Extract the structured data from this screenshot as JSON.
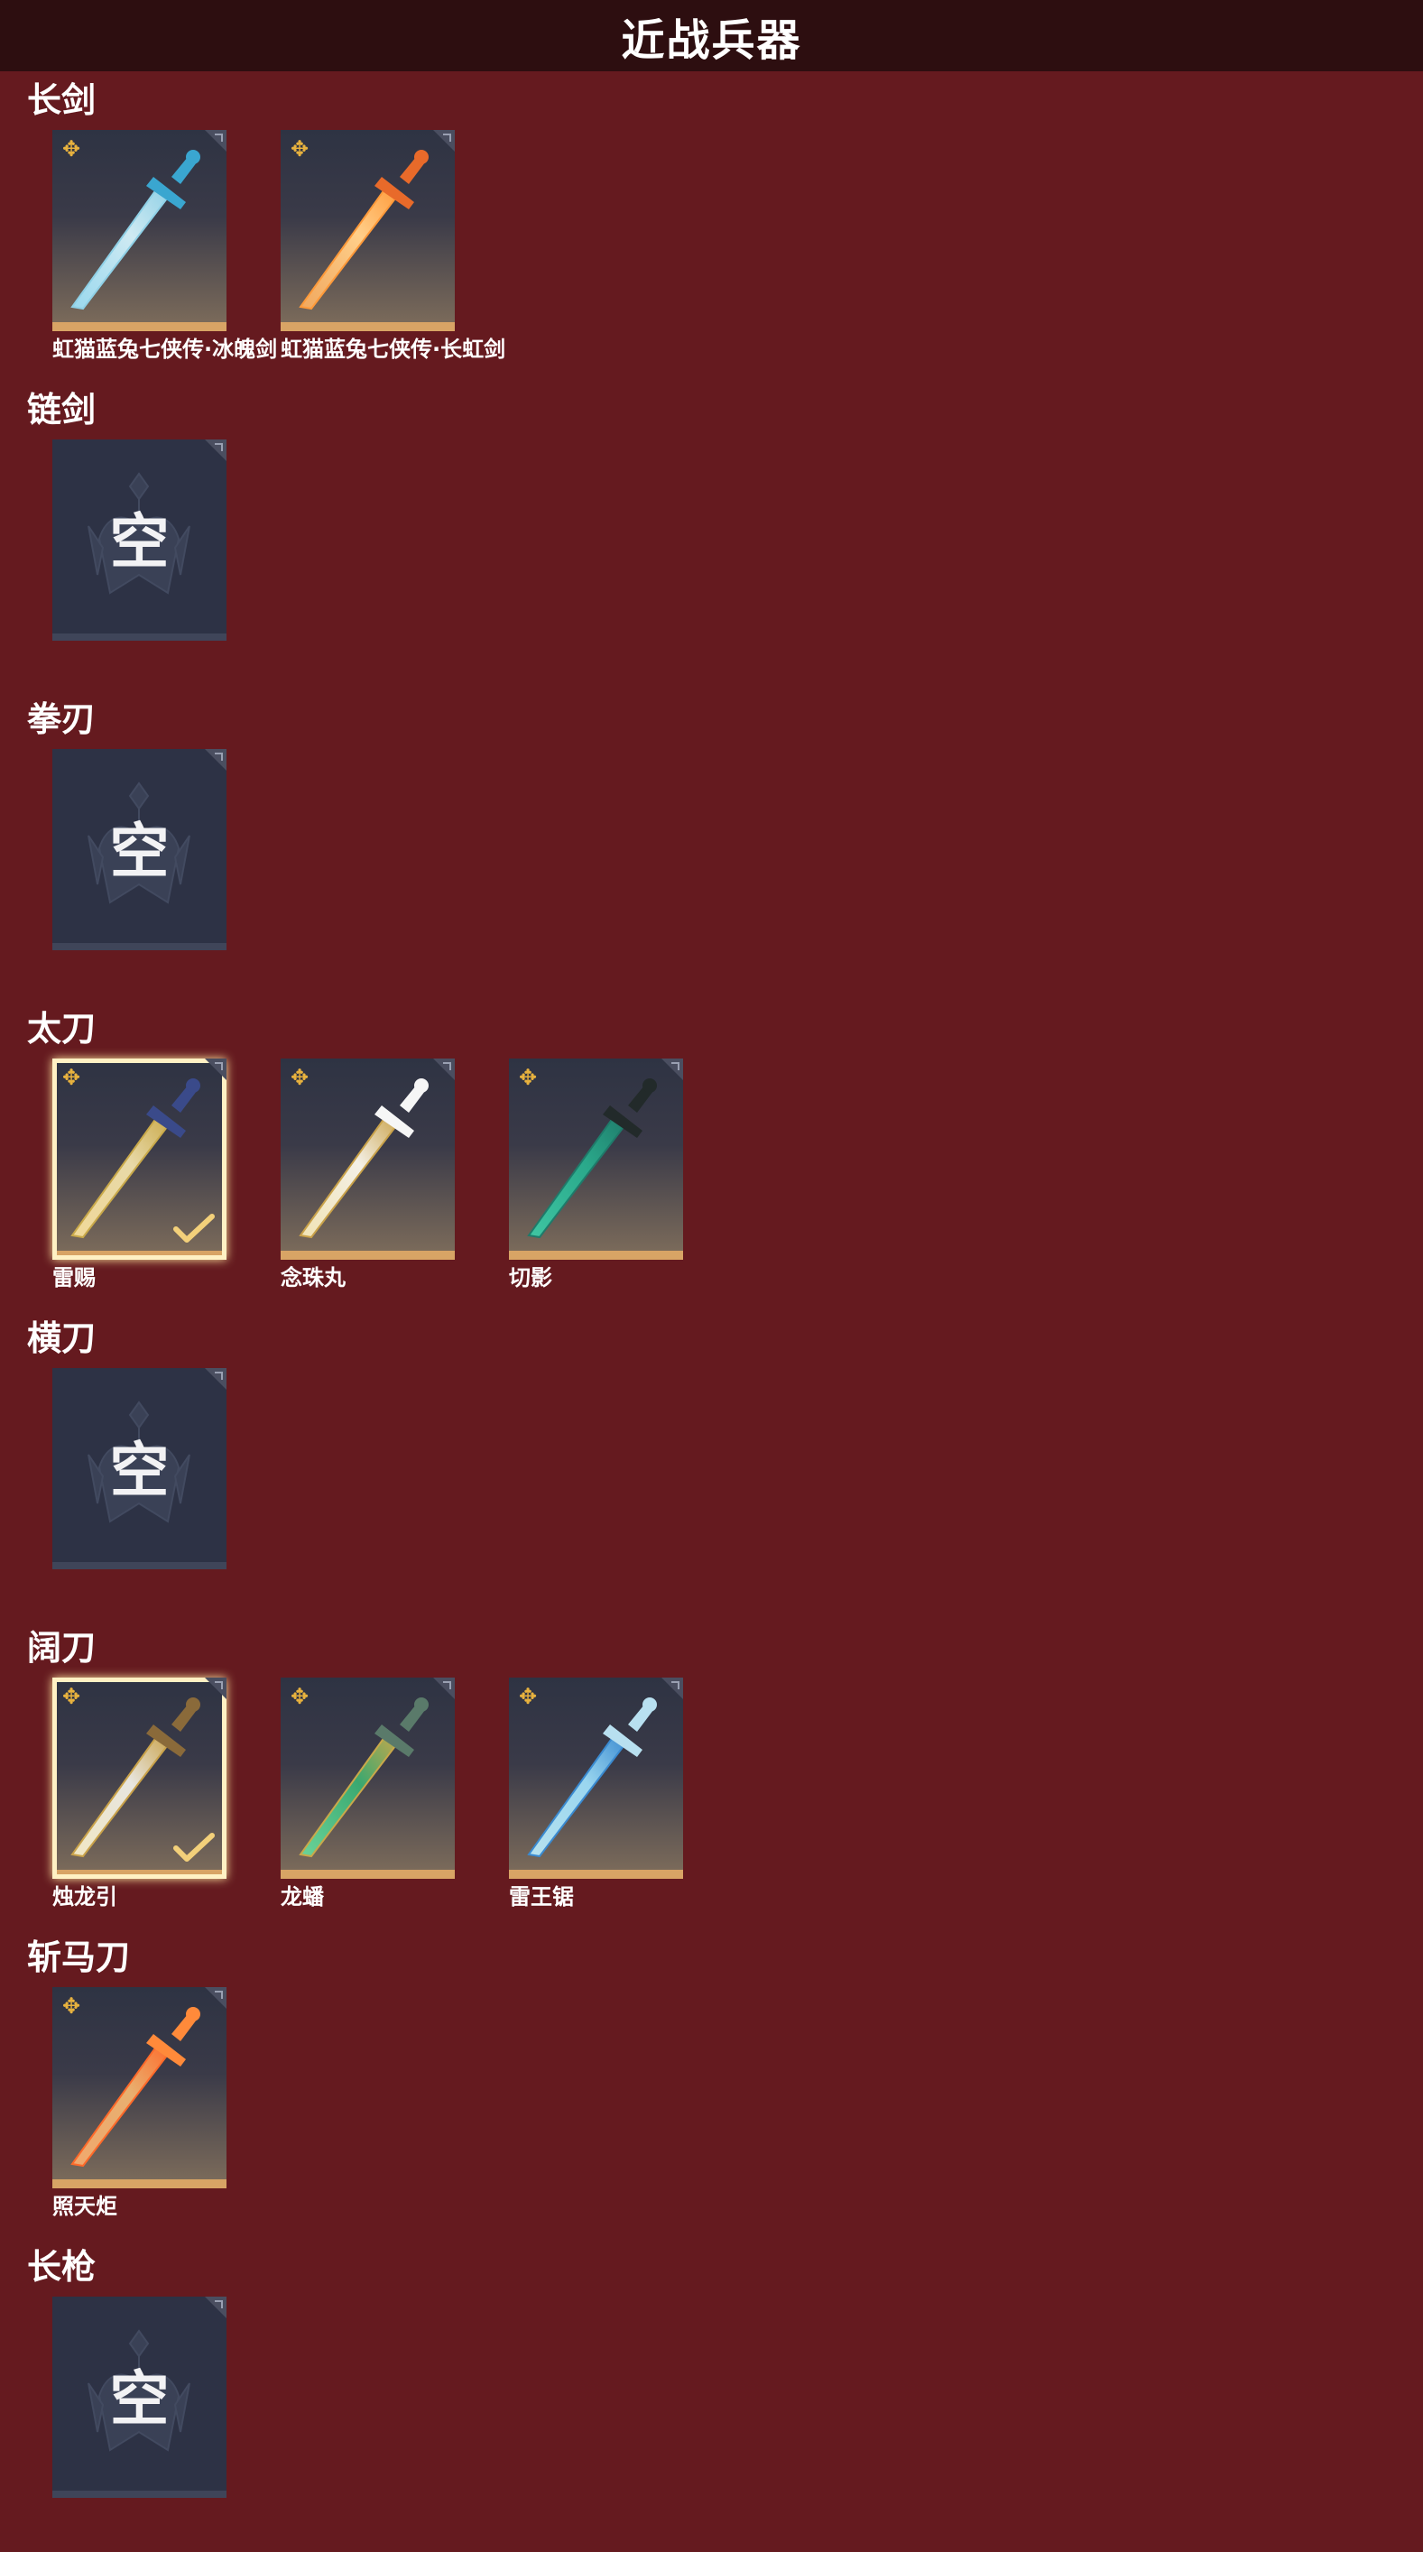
{
  "header": {
    "title": "近战兵器"
  },
  "colors": {
    "background": "#651a1f",
    "header": "#2d0e10",
    "rarity_bar": "#d8a465",
    "star": "#e8b23e"
  },
  "empty_label": "空",
  "sections": [
    {
      "title": "长剑",
      "items": [
        {
          "name": "虹猫蓝兔七侠传·冰魄剑",
          "icon": "ice-sword-icon",
          "equipped": false
        },
        {
          "name": "虹猫蓝兔七侠传·长虹剑",
          "icon": "flame-sword-icon",
          "equipped": false
        }
      ]
    },
    {
      "title": "链剑",
      "items": []
    },
    {
      "title": "拳刃",
      "items": []
    },
    {
      "title": "太刀",
      "items": [
        {
          "name": "雷赐",
          "icon": "golden-katana-icon",
          "equipped": true
        },
        {
          "name": "念珠丸",
          "icon": "white-katana-icon",
          "equipped": false
        },
        {
          "name": "切影",
          "icon": "jade-katana-icon",
          "equipped": false
        }
      ]
    },
    {
      "title": "横刀",
      "items": []
    },
    {
      "title": "阔刀",
      "items": [
        {
          "name": "烛龙引",
          "icon": "dragon-broadblade-icon",
          "equipped": true
        },
        {
          "name": "龙蟠",
          "icon": "green-broadblade-icon",
          "equipped": false
        },
        {
          "name": "雷王锯",
          "icon": "lightning-broadblade-icon",
          "equipped": false
        }
      ]
    },
    {
      "title": "斩马刀",
      "items": [
        {
          "name": "照天炬",
          "icon": "flame-zhanmadao-icon",
          "equipped": false
        }
      ]
    },
    {
      "title": "长枪",
      "items": []
    }
  ]
}
